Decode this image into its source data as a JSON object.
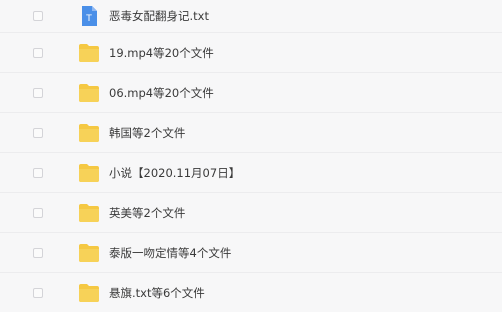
{
  "files": [
    {
      "name": "恶毒女配翻身记.txt",
      "type": "txt",
      "icon": "text-file-icon"
    },
    {
      "name": "19.mp4等20个文件",
      "type": "folder",
      "icon": "folder-icon"
    },
    {
      "name": "06.mp4等20个文件",
      "type": "folder",
      "icon": "folder-icon"
    },
    {
      "name": "韩国等2个文件",
      "type": "folder",
      "icon": "folder-icon"
    },
    {
      "name": "小说【2020.11月07日】",
      "type": "folder",
      "icon": "folder-icon"
    },
    {
      "name": "英美等2个文件",
      "type": "folder",
      "icon": "folder-icon"
    },
    {
      "name": "泰版一吻定情等4个文件",
      "type": "folder",
      "icon": "folder-icon"
    },
    {
      "name": "悬旗.txt等6个文件",
      "type": "folder",
      "icon": "folder-icon"
    }
  ],
  "colors": {
    "folder": "#f5c842",
    "txt_icon": "#4a8fe8",
    "background": "#f7f7f8"
  }
}
